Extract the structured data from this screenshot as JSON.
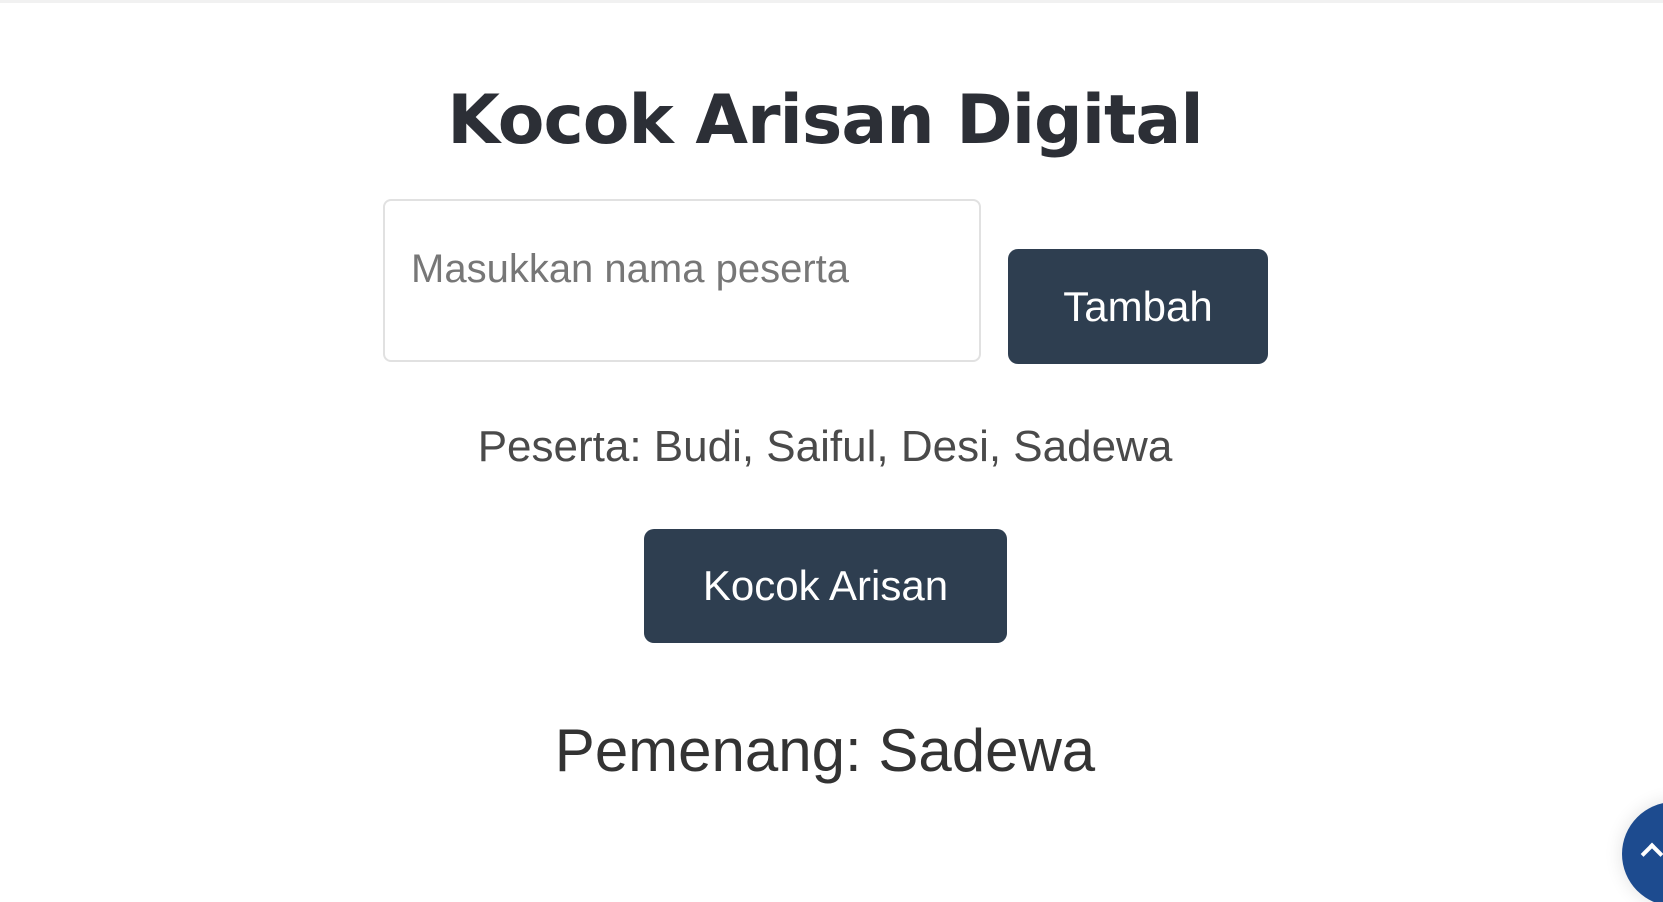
{
  "header": {
    "title": "Kocok Arisan Digital"
  },
  "form": {
    "name_placeholder": "Masukkan nama peserta",
    "name_value": "",
    "add_label": "Tambah"
  },
  "participants": {
    "text": "Peserta: Budi, Saiful, Desi, Sadewa"
  },
  "actions": {
    "draw_label": "Kocok Arisan"
  },
  "result": {
    "text": "Pemenang: Sadewa"
  },
  "floating_button": {
    "icon": "chevron-up-icon",
    "color": "#1d4b8f"
  },
  "colors": {
    "button_bg": "#2e3e50",
    "title": "#2c2f36"
  }
}
